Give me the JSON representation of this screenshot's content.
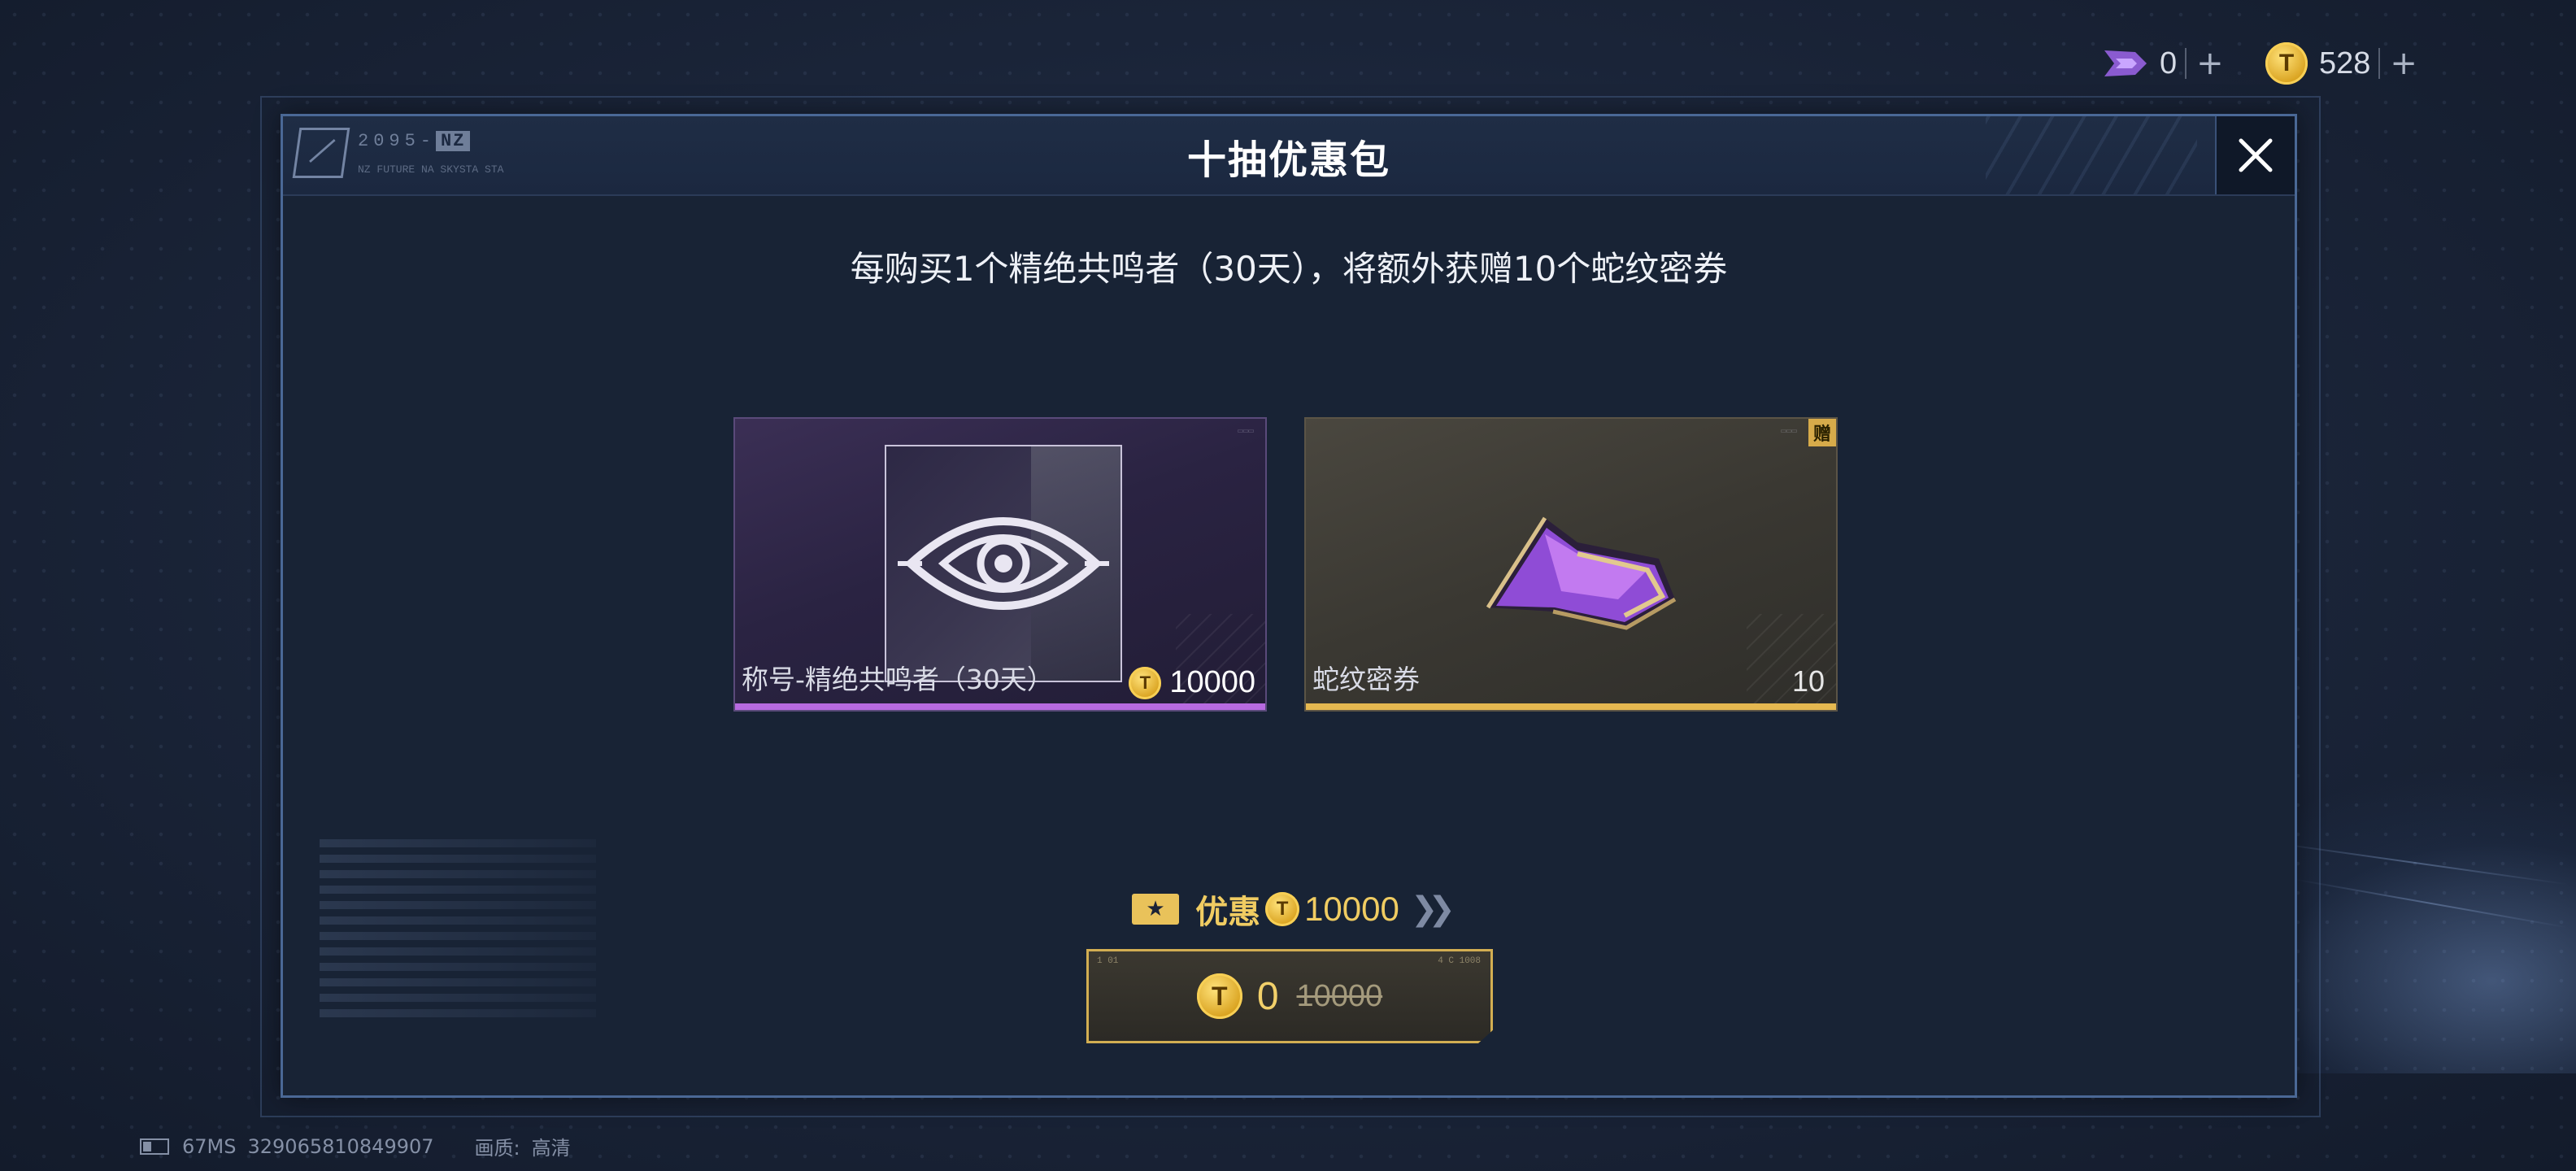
{
  "currency_bar": {
    "premium_value": "0",
    "coin_value": "528",
    "plus_label": "+",
    "premium_icon": "purple-wing-icon",
    "coin_icon": "gold-coin-icon"
  },
  "dialog": {
    "header_tag": "2095-",
    "header_tag_badge": "NZ",
    "header_sub": "NZ FUTURE NA SKYSTA  STA",
    "title": "十抽优惠包",
    "close_icon": "close-icon",
    "description": "每购买1个精绝共鸣者（30天），将额外获赠10个蛇纹密券"
  },
  "items": [
    {
      "name": "称号-精绝共鸣者（30天）",
      "price": "10000",
      "rarity_color": "#b76ae0",
      "icon": "eye-emblem-icon"
    },
    {
      "name": "蛇纹密券",
      "count": "10",
      "gift_badge": "赠",
      "rarity_color": "#e5b850",
      "icon": "purple-crystal-ticket-icon"
    }
  ],
  "discount": {
    "label": "优惠",
    "value": "10000",
    "ticket_icon": "star-ticket-icon",
    "chevron_icon": "double-chevron-right-icon"
  },
  "buy_button": {
    "price": "0",
    "original_price": "10000",
    "corner_tl": "1 01",
    "corner_tr": "4 C 1008"
  },
  "status_bar": {
    "ping": "67MS",
    "user_id": "329065810849907",
    "quality_label": "画质:",
    "quality_value": "高清"
  },
  "colors": {
    "accent_gold": "#f0cc62",
    "panel_border": "#4a6896",
    "background": "#1a2438"
  }
}
